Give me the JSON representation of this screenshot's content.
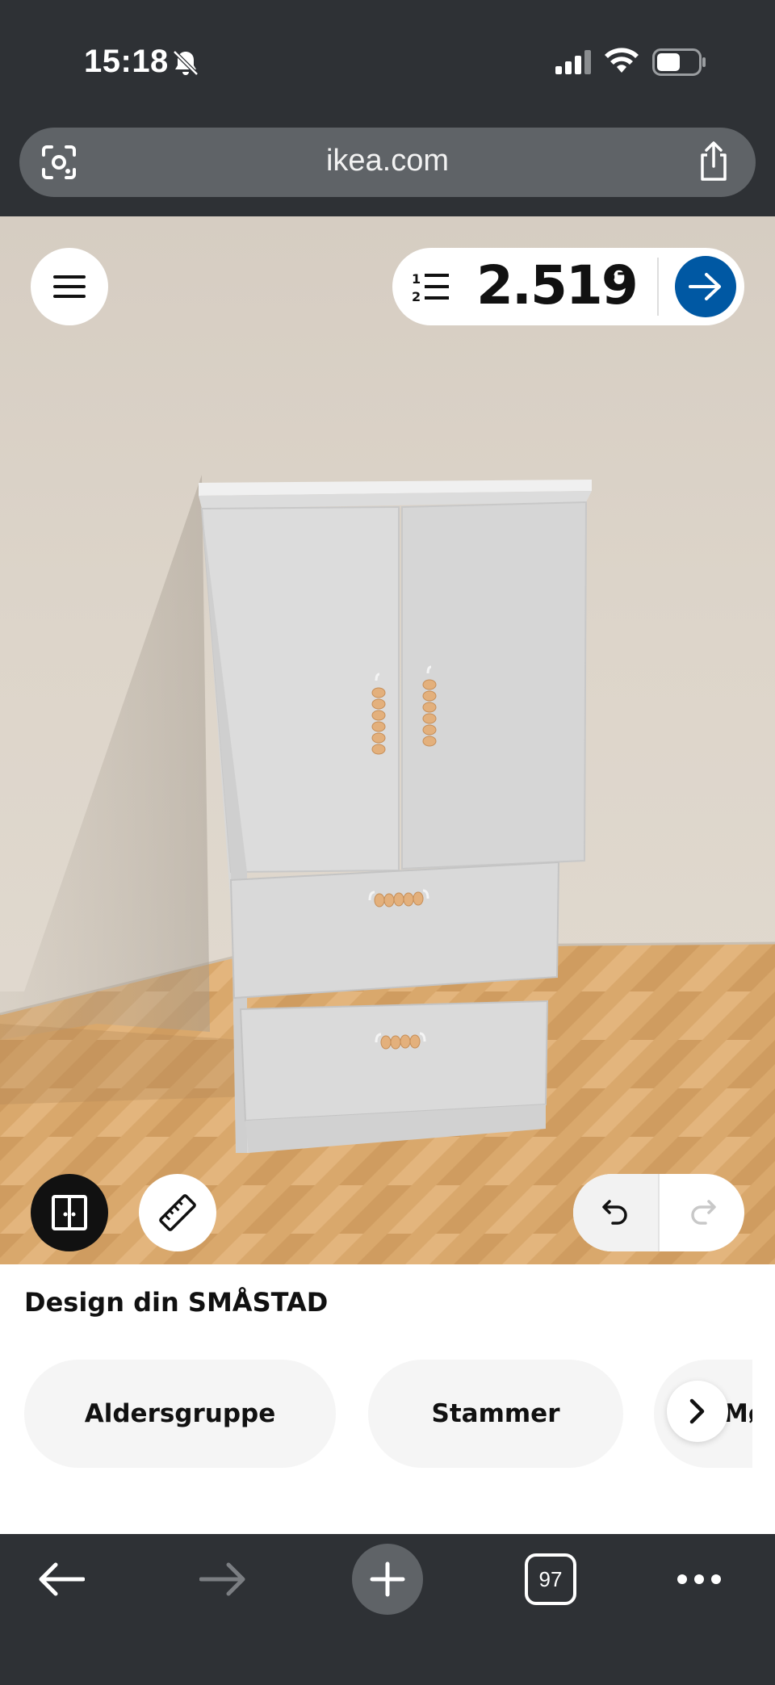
{
  "status_bar": {
    "time": "15:18",
    "icons": [
      "bell-off-icon",
      "signal-icon",
      "wifi-icon",
      "battery-icon"
    ]
  },
  "browser": {
    "url": "ikea.com",
    "icons": [
      "lens-icon",
      "share-icon"
    ]
  },
  "planner": {
    "price": "2.519",
    "price_suffix": ",–",
    "accent_color": "#0058a3",
    "icons": [
      "menu-icon",
      "numbered-list-icon",
      "arrow-right-icon",
      "front-view-icon",
      "ruler-icon",
      "undo-icon",
      "redo-icon"
    ]
  },
  "panel": {
    "title": "Design din SMÅSTAD",
    "chips": [
      {
        "label": "Aldersgruppe"
      },
      {
        "label": "Stammer"
      },
      {
        "label": "Mø"
      }
    ]
  },
  "toolbar": {
    "tab_count": "97",
    "icons": [
      "back-arrow-icon",
      "forward-arrow-icon",
      "plus-icon",
      "tabs-icon",
      "more-icon"
    ]
  }
}
